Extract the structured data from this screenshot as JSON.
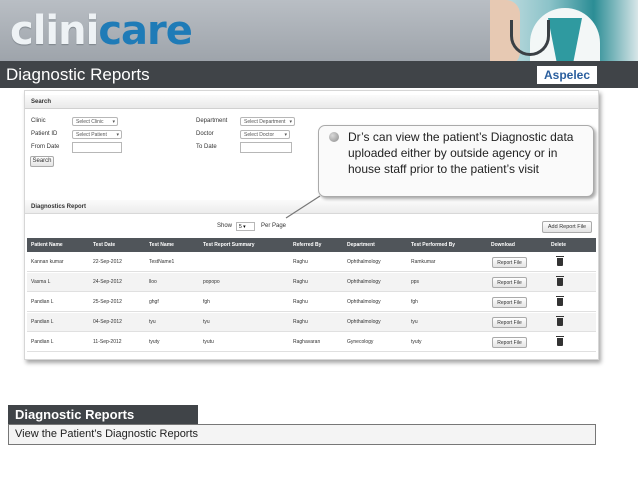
{
  "logo": {
    "part1": "clini",
    "part2": "care"
  },
  "header": {
    "title": "Diagnostic Reports",
    "brand": "Aspelec"
  },
  "search": {
    "heading": "Search",
    "clinic_label": "Clinic",
    "clinic_value": "Select Clinic",
    "department_label": "Department",
    "department_value": "Select Department",
    "patient_id_label": "Patient ID",
    "patient_value": "Select Patient",
    "doctor_label": "Doctor",
    "doctor_value": "Select Doctor",
    "from_date_label": "From Date",
    "to_date_label": "To Date",
    "search_button": "Search"
  },
  "report": {
    "heading": "Diagnostics Report",
    "show_label": "Show",
    "show_value": "5",
    "per_page_label": "Per Page",
    "add_button": "Add Report File",
    "columns": [
      "Patient Name",
      "Test Date",
      "Test Name",
      "Test Report Summary",
      "Referred By",
      "Department",
      "Test Performed By",
      "Download",
      "Delete"
    ],
    "rows": [
      {
        "patient": "Kannan kumar",
        "date": "22-Sep-2012",
        "test": "TestName1",
        "summary": "",
        "referred": "Raghu",
        "department": "Ophthalmology",
        "performed": "Ramkumar",
        "download": "Report File"
      },
      {
        "patient": "Vasma L",
        "date": "24-Sep-2012",
        "test": "lloo",
        "summary": "popopo",
        "referred": "Raghu",
        "department": "Ophthalmology",
        "performed": "pps",
        "download": "Report File"
      },
      {
        "patient": "Pandian L",
        "date": "25-Sep-2012",
        "test": "ghgf",
        "summary": "fgh",
        "referred": "Raghu",
        "department": "Ophthalmology",
        "performed": "fgh",
        "download": "Report File"
      },
      {
        "patient": "Pandian L",
        "date": "04-Sep-2012",
        "test": "tyu",
        "summary": "tyu",
        "referred": "Raghu",
        "department": "Ophthalmology",
        "performed": "tyu",
        "download": "Report File"
      },
      {
        "patient": "Pandian L",
        "date": "11-Sep-2012",
        "test": "tyuty",
        "summary": "tyutu",
        "referred": "Raghavaran",
        "department": "Gynecology",
        "performed": "tyuty",
        "download": "Report File"
      }
    ]
  },
  "callout": {
    "text": "Dr’s can view the patient’s Diagnostic data uploaded either by outside agency or in house staff prior to the patient’s visit"
  },
  "caption": {
    "title": "Diagnostic Reports",
    "description": "View the Patient’s Diagnostic Reports"
  }
}
